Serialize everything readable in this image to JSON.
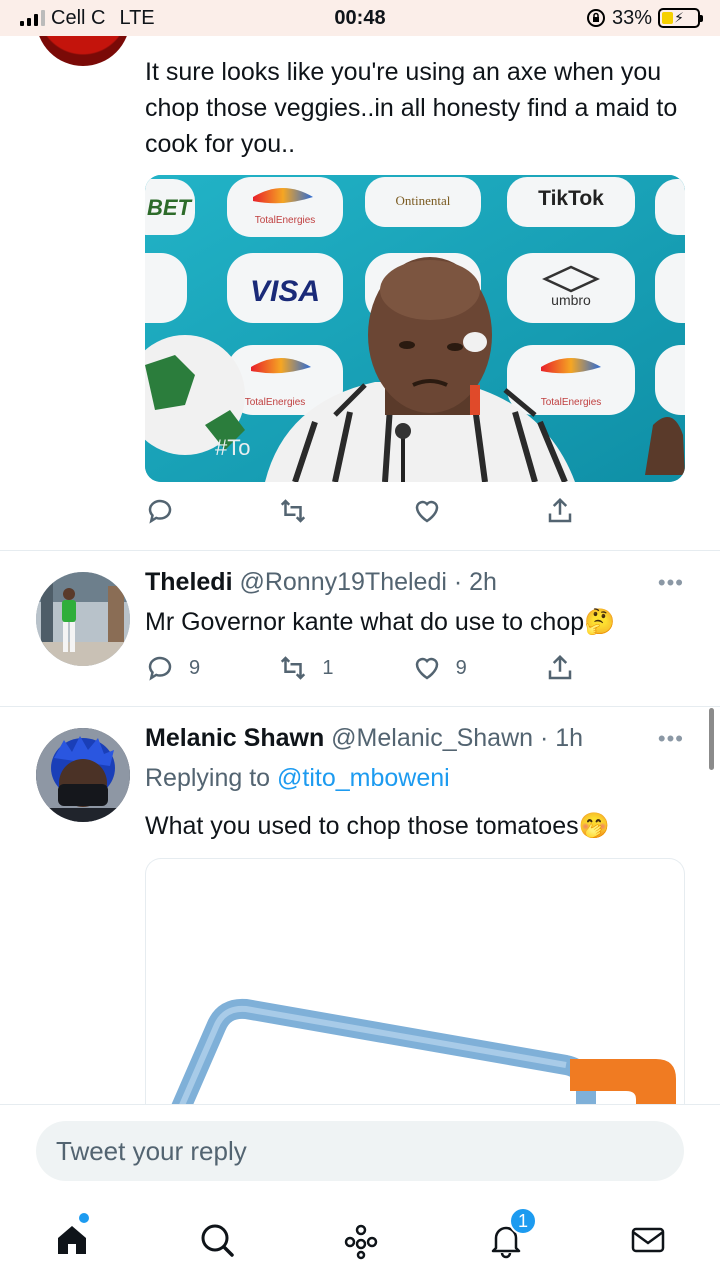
{
  "status_bar": {
    "carrier": "Cell C",
    "network": "LTE",
    "time": "00:48",
    "battery": "33%",
    "battery_level": 0.33
  },
  "tweets": [
    {
      "text": "It sure looks like you're using an axe when you chop those veggies..in all honesty find a maid to cook for you..",
      "media": {
        "sponsor_1": "BET",
        "sponsor_2": "TotalEnergies",
        "sponsor_3": "Ontinental",
        "sponsor_4": "TikTok",
        "sponsor_5": "VISA",
        "sponsor_6": "umbro",
        "sponsor_7": "TotalEnergies",
        "sponsor_8": "TotalEnergies",
        "hashtag": "#To"
      },
      "actions": {
        "reply": "",
        "retweet": "",
        "like": ""
      }
    },
    {
      "name": "Theledi",
      "handle": "@Ronny19Theledi",
      "time": "· 2h",
      "text": "Mr Governor kante what do use to chop",
      "emoji": "🤔",
      "actions": {
        "reply": "9",
        "retweet": "1",
        "like": "9"
      }
    },
    {
      "name": "Melanic Shawn",
      "handle": "@Melanic_Shawn",
      "time": "· 1h",
      "replying_prefix": "Replying to",
      "replying_to": "@tito_mboweni",
      "text": "What you used to chop those tomatoes",
      "emoji": "🤭"
    }
  ],
  "more_icon": "•••",
  "reply_box": {
    "placeholder": "Tweet your reply"
  },
  "tabs": [
    {
      "icon": "home-icon"
    },
    {
      "icon": "search-icon"
    },
    {
      "icon": "spaces-icon"
    },
    {
      "icon": "notifications-icon",
      "badge": "1"
    },
    {
      "icon": "messages-icon"
    }
  ],
  "colors": {
    "accent": "#1d9bf0",
    "muted": "#536471",
    "text": "#0f1419"
  }
}
